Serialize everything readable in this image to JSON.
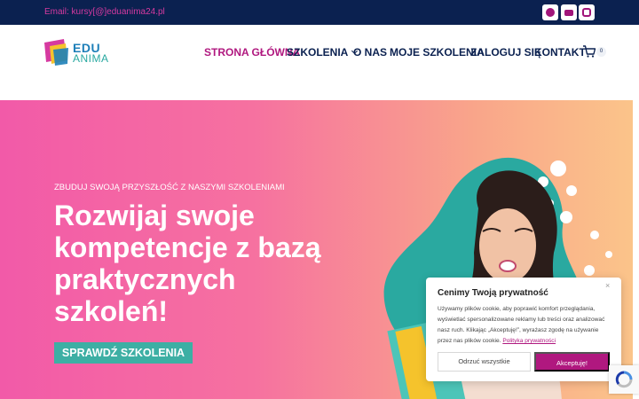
{
  "topbar": {
    "email": "Email: kursy[@]eduanima24.pl",
    "social": [
      "facebook-icon",
      "youtube-icon",
      "instagram-icon"
    ]
  },
  "brand": {
    "line1": "EDU",
    "line2": "ANIMA"
  },
  "nav": {
    "items": [
      {
        "label": "STRONA GŁÓWNA",
        "active": true
      },
      {
        "label": "SZKOLENIA"
      },
      {
        "label": "O NAS"
      },
      {
        "label": "MOJE SZKOLENIA"
      },
      {
        "label": "ZALOGUJ SIĘ"
      },
      {
        "label": "KONTAKT"
      }
    ],
    "cart_count": "0"
  },
  "hero": {
    "kicker": "ZBUDUJ SWOJĄ PRZYSZŁOŚĆ Z NASZYMI SZKOLENIAMI",
    "title": "Rozwijaj swoje kompetencje z bazą praktycznych szkoleń!",
    "cta": "SPRAWDŹ SZKOLENIA"
  },
  "cookie": {
    "title": "Cenimy Twoją prywatność",
    "body": "Używamy plików cookie, aby poprawić komfort przeglądania, wyświetlać spersonalizowane reklamy lub treści oraz analizować nasz ruch. Klikając „Akceptuję!”, wyrażasz zgodę na używanie przez nas plików cookie. ",
    "link": "Polityka prywatności",
    "decline": "Odrzuć wszystkie",
    "accept": "Akceptuję!",
    "close": "×"
  },
  "colors": {
    "navy": "#0b2150",
    "magenta": "#b0187f",
    "teal": "#3dafa4"
  }
}
